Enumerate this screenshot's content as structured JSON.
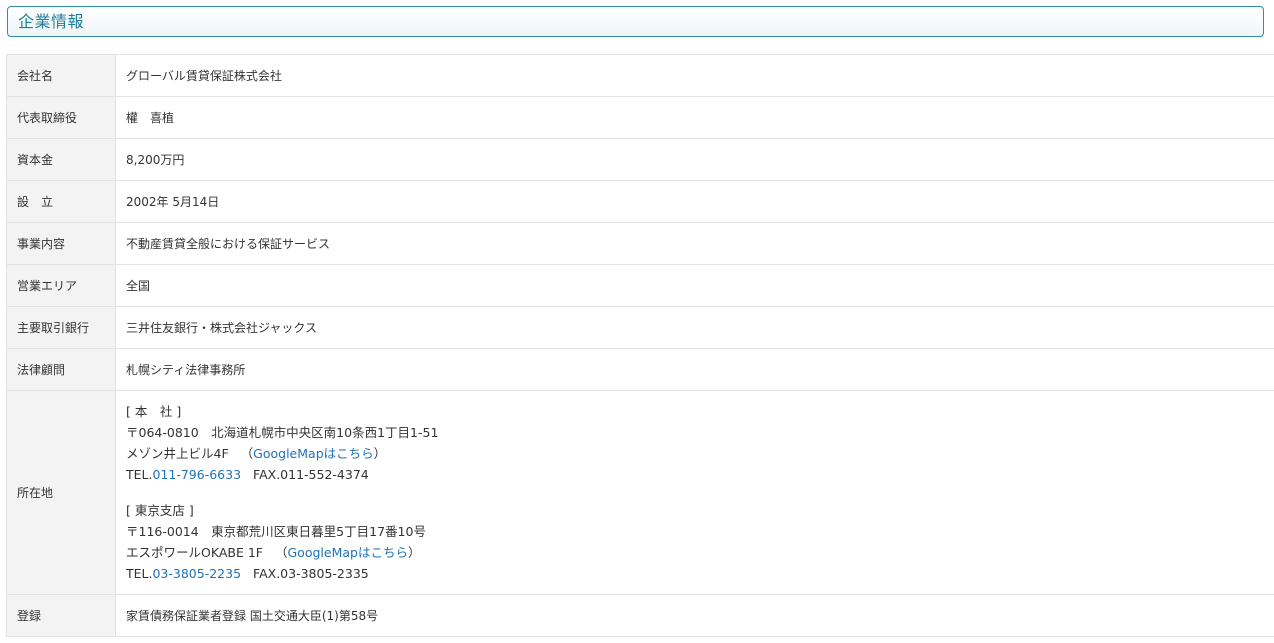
{
  "header": {
    "title": "企業情報"
  },
  "rows": {
    "company_name": {
      "label": "会社名",
      "value": "グローバル賃貸保証株式会社"
    },
    "representative": {
      "label": "代表取締役",
      "value": "權　喜植"
    },
    "capital": {
      "label": "資本金",
      "value": "8,200万円"
    },
    "established": {
      "label": "設　立",
      "value": "2002年 5月14日"
    },
    "business": {
      "label": "事業内容",
      "value": "不動産賃貸全般における保証サービス"
    },
    "area": {
      "label": "営業エリア",
      "value": "全国"
    },
    "bank": {
      "label": "主要取引銀行",
      "value": "三井住友銀行・株式会社ジャックス"
    },
    "legal": {
      "label": "法律顧問",
      "value": "札幌シティ法律事務所"
    },
    "registration": {
      "label": "登録",
      "value": "家賃債務保証業者登録 国土交通大臣(1)第58号"
    }
  },
  "address": {
    "label": "所在地",
    "head_office": {
      "heading": "[ 本　社 ]",
      "postal_line": "〒064-0810　北海道札幌市中央区南10条西1丁目1-51",
      "building": "メゾン井上ビル4F",
      "map_link": "GoogleMapはこちら",
      "tel_prefix": "TEL.",
      "tel": "011-796-6633",
      "fax": "FAX.011-552-4374"
    },
    "tokyo_branch": {
      "heading": "[ 東京支店 ]",
      "postal_line": "〒116-0014　東京都荒川区東日暮里5丁目17番10号",
      "building": "エスポワールOKABE 1F",
      "map_link": "GoogleMapはこちら",
      "tel_prefix": "TEL.",
      "tel": "03-3805-2235",
      "fax": "FAX.03-3805-2335"
    }
  },
  "colors": {
    "accent": "#1d7e9a",
    "link": "#1f72b8",
    "label_bg": "#f3f3f3",
    "border": "#e2e2e2"
  }
}
